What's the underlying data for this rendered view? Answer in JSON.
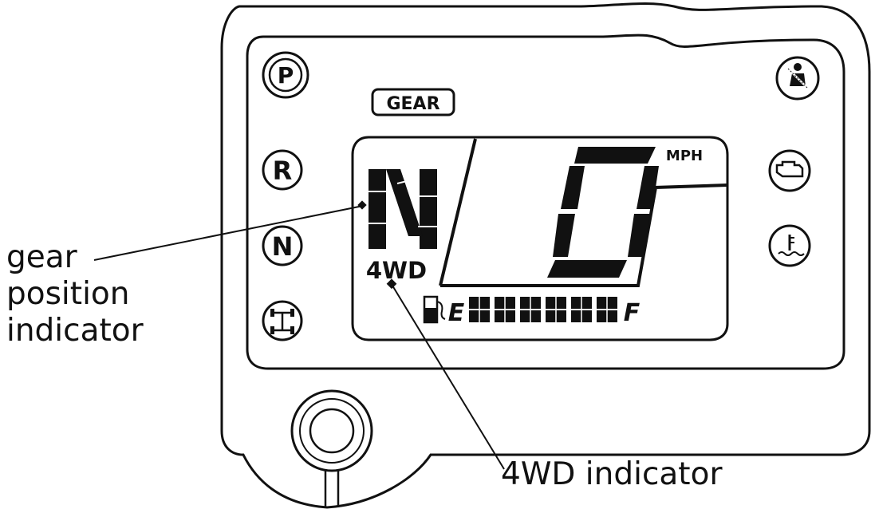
{
  "panel": {
    "gear_tag": "GEAR",
    "units": "MPH",
    "mode_label": "4WD",
    "gear_glyph": "N",
    "speed_glyph": "0",
    "fuel_empty": "E",
    "fuel_full": "F"
  },
  "indicators": {
    "left": [
      "P",
      "R",
      "N",
      "4x4-icon"
    ],
    "right": [
      "seatbelt-icon",
      "check-engine-icon",
      "coolant-temp-icon"
    ]
  },
  "callouts": {
    "gear_position_lines": [
      "gear",
      "position",
      "indicator"
    ],
    "wd_indicator": "4WD indicator"
  }
}
